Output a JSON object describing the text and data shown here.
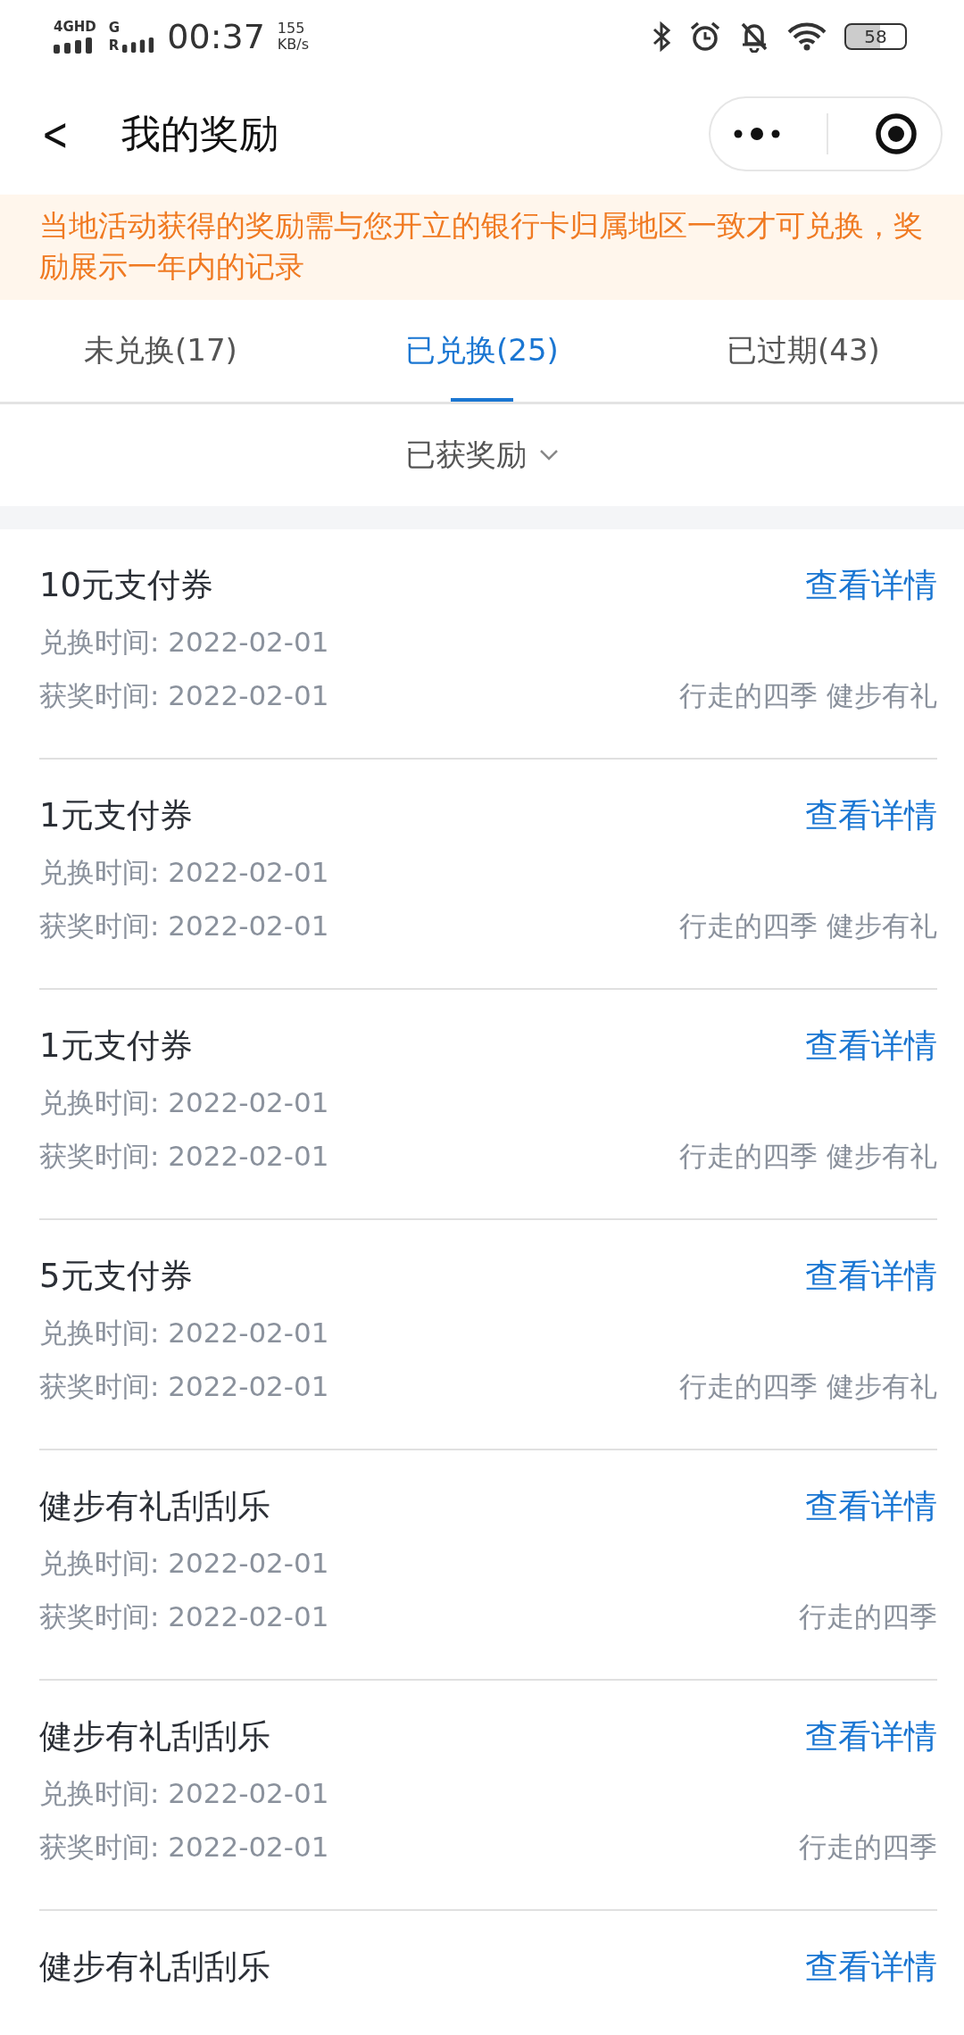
{
  "status_bar": {
    "network_1": "4GHD",
    "network_2": "G",
    "roaming": "R",
    "time": "00:37",
    "speed": "155",
    "speed_unit": "KB/s",
    "battery": "58"
  },
  "header": {
    "back": "<",
    "title": "我的奖励"
  },
  "notice": "当地活动获得的奖励需与您开立的银行卡归属地区一致才可兑换，奖励展示一年内的记录",
  "tabs": [
    {
      "label": "未兑换(17)",
      "selected": false
    },
    {
      "label": "已兑换(25)",
      "selected": true
    },
    {
      "label": "已过期(43)",
      "selected": false
    }
  ],
  "filter": {
    "label": "已获奖励"
  },
  "rewards": [
    {
      "title": "10元支付券",
      "link": "查看详情",
      "exchange_time": "兑换时间: 2022-02-01",
      "award_time": "获奖时间: 2022-02-01",
      "source": "行走的四季 健步有礼"
    },
    {
      "title": "1元支付券",
      "link": "查看详情",
      "exchange_time": "兑换时间: 2022-02-01",
      "award_time": "获奖时间: 2022-02-01",
      "source": "行走的四季 健步有礼"
    },
    {
      "title": "1元支付券",
      "link": "查看详情",
      "exchange_time": "兑换时间: 2022-02-01",
      "award_time": "获奖时间: 2022-02-01",
      "source": "行走的四季 健步有礼"
    },
    {
      "title": "5元支付券",
      "link": "查看详情",
      "exchange_time": "兑换时间: 2022-02-01",
      "award_time": "获奖时间: 2022-02-01",
      "source": "行走的四季 健步有礼"
    },
    {
      "title": "健步有礼刮刮乐",
      "link": "查看详情",
      "exchange_time": "兑换时间: 2022-02-01",
      "award_time": "获奖时间: 2022-02-01",
      "source": "行走的四季"
    },
    {
      "title": "健步有礼刮刮乐",
      "link": "查看详情",
      "exchange_time": "兑换时间: 2022-02-01",
      "award_time": "获奖时间: 2022-02-01",
      "source": "行走的四季"
    },
    {
      "title": "健步有礼刮刮乐",
      "link": "查看详情"
    }
  ]
}
